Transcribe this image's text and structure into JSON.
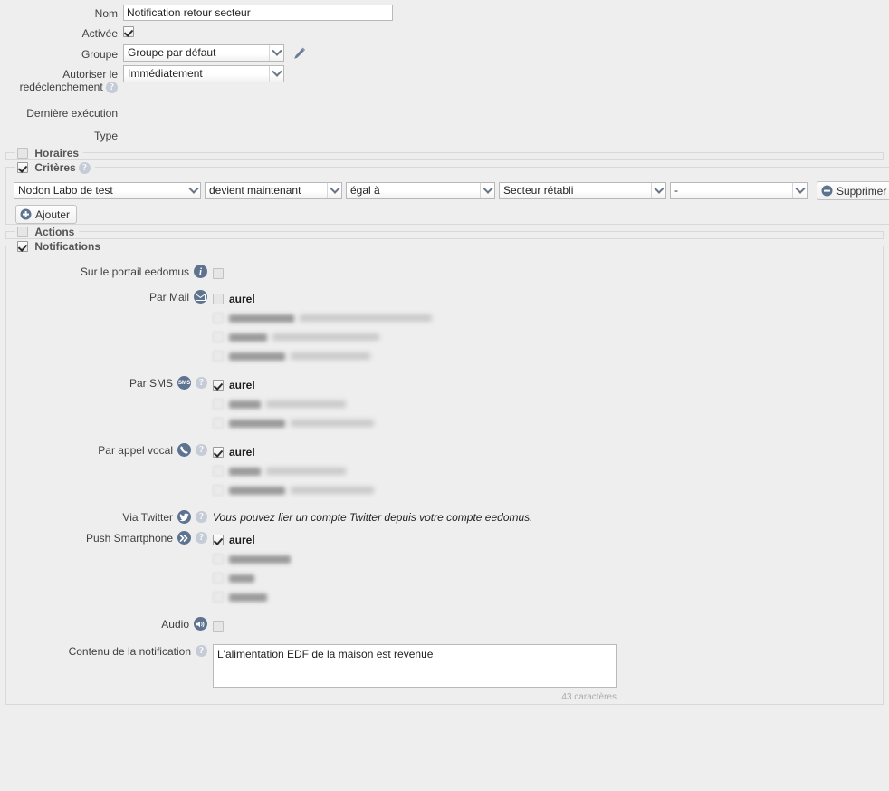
{
  "form": {
    "name_label": "Nom",
    "name_value": "Notification retour secteur",
    "enabled_label": "Activée",
    "group_label": "Groupe",
    "group_value": "Groupe par défaut",
    "retrigger_label_line1": "Autoriser le",
    "retrigger_label_line2": "redéclenchement",
    "retrigger_value": "Immédiatement",
    "last_exec_label": "Dernière exécution",
    "type_label": "Type",
    "edit_group_icon": "pencil-icon",
    "help_icon": "help-icon"
  },
  "sections": {
    "horaires": {
      "legend": "Horaires",
      "checked": false
    },
    "actions": {
      "legend": "Actions",
      "checked": false
    },
    "criteres": {
      "legend": "Critères",
      "checked": true
    },
    "notifications": {
      "legend": "Notifications",
      "checked": true
    }
  },
  "criteria": {
    "rows": [
      {
        "device": "Nodon Labo de test",
        "event": "devient maintenant",
        "operator": "égal à",
        "value": "Secteur rétabli",
        "extra": "-",
        "delete_label": "Supprimer"
      }
    ],
    "add_label": "Ajouter"
  },
  "notifications": {
    "channels": [
      {
        "label": "Sur le portail eedomus",
        "icon": "info-icon",
        "icon_glyph": "i",
        "has_help": false,
        "recipients": [
          {
            "checked": false,
            "name": "",
            "address": "",
            "redacted": false,
            "empty": true
          }
        ]
      },
      {
        "label": "Par Mail",
        "icon": "mail-icon",
        "icon_glyph": "✉",
        "has_help": false,
        "recipients": [
          {
            "checked": false,
            "name": "aurel",
            "address": "",
            "redacted": false,
            "faint": true,
            "addr_width": 145
          },
          {
            "checked": false,
            "redacted": true,
            "name_width": 72,
            "addr_width": 146
          },
          {
            "checked": false,
            "redacted": true,
            "name_width": 42,
            "addr_width": 118
          },
          {
            "checked": false,
            "redacted": true,
            "name_width": 62,
            "addr_width": 88
          }
        ]
      },
      {
        "label": "Par SMS",
        "icon": "sms-icon",
        "icon_glyph": "SMS",
        "has_help": true,
        "recipients": [
          {
            "checked": true,
            "name": "aurel",
            "address": "",
            "redacted": false,
            "faint": true,
            "addr_width": 90
          },
          {
            "checked": false,
            "redacted": true,
            "name_width": 35,
            "addr_width": 88
          },
          {
            "checked": false,
            "redacted": true,
            "name_width": 62,
            "addr_width": 92
          }
        ]
      },
      {
        "label": "Par appel vocal",
        "icon": "phone-icon",
        "icon_glyph": "☎",
        "has_help": true,
        "recipients": [
          {
            "checked": true,
            "name": "aurel",
            "address": "",
            "redacted": false,
            "faint": true,
            "addr_width": 90
          },
          {
            "checked": false,
            "redacted": true,
            "name_width": 35,
            "addr_width": 88
          },
          {
            "checked": false,
            "redacted": true,
            "name_width": 62,
            "addr_width": 92
          }
        ]
      },
      {
        "label": "Via Twitter",
        "icon": "twitter-icon",
        "icon_glyph": "✓",
        "has_help": true,
        "note": "Vous pouvez lier un compte Twitter depuis votre compte eedomus."
      },
      {
        "label": "Push Smartphone",
        "icon": "push-icon",
        "icon_glyph": "»",
        "has_help": true,
        "recipients": [
          {
            "checked": true,
            "name": "aurel",
            "address": "",
            "redacted": false
          },
          {
            "checked": false,
            "redacted": true,
            "name_width": 68,
            "addr_width": 0
          },
          {
            "checked": false,
            "redacted": true,
            "name_width": 28,
            "addr_width": 0
          },
          {
            "checked": false,
            "redacted": true,
            "name_width": 42,
            "addr_width": 0
          }
        ]
      },
      {
        "label": "Audio",
        "icon": "speaker-icon",
        "icon_glyph": "◂",
        "has_help": false,
        "recipients": [
          {
            "checked": false,
            "name": "",
            "address": "",
            "redacted": false,
            "empty": true
          }
        ]
      }
    ],
    "content_label": "Contenu de la notification",
    "content_value": "L'alimentation EDF de la maison est revenue",
    "char_count": "43 caractères"
  },
  "colors": {
    "page_bg": "#eeeeee",
    "icon_blue": "#5d7390",
    "help_grey": "#c5ccd6",
    "border": "#d8d8d8"
  }
}
